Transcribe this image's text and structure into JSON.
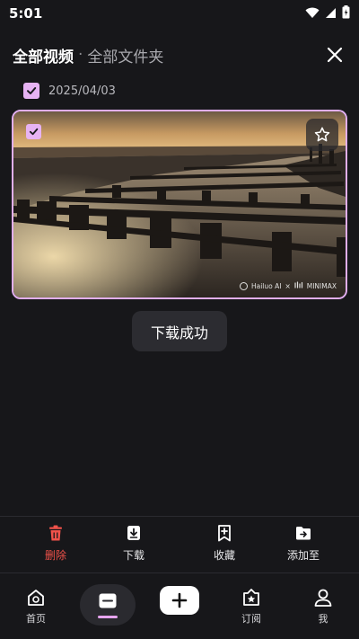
{
  "status_bar": {
    "time": "5:01"
  },
  "header": {
    "title": "全部视频",
    "separator": "·",
    "subtitle": "全部文件夹"
  },
  "date_group": {
    "date": "2025/04/03",
    "checked": true
  },
  "video_card": {
    "selected": true,
    "watermark_left": "Hailuo AI",
    "watermark_mid": "×",
    "watermark_right": "MINIMAX",
    "icons": {
      "favorite": "star-icon",
      "check": "check-icon"
    }
  },
  "toast": {
    "message": "下载成功"
  },
  "actions": {
    "delete": "删除",
    "download": "下载",
    "collect": "收藏",
    "add_to": "添加至"
  },
  "nav": {
    "home": "首页",
    "subscribe": "订阅",
    "me": "我"
  },
  "colors": {
    "accent": "#e7b3f3",
    "danger": "#f0524a",
    "background": "#17171a"
  }
}
